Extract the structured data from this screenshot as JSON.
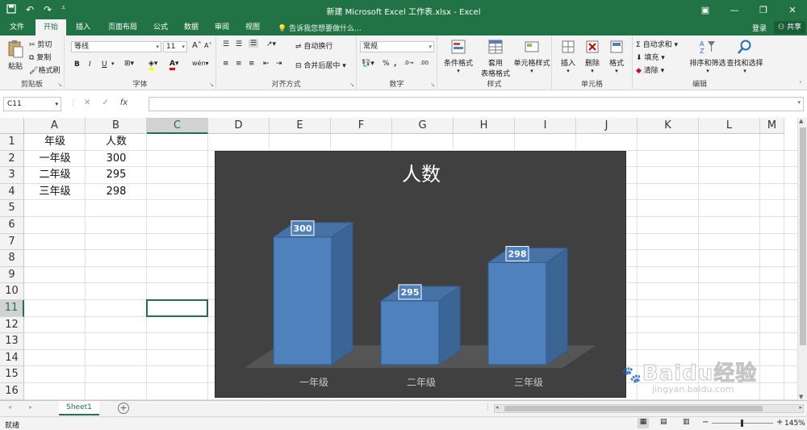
{
  "window": {
    "title": "新建 Microsoft Excel 工作表.xlsx - Excel"
  },
  "ribbon_tabs": [
    "文件",
    "开始",
    "插入",
    "页面布局",
    "公式",
    "数据",
    "审阅",
    "视图"
  ],
  "active_tab": "开始",
  "tell_me": "告诉我您想要做什么...",
  "account": {
    "signin": "登录",
    "share": "共享"
  },
  "clipboard": {
    "paste": "粘贴",
    "cut": "剪切",
    "copy": "复制",
    "painter": "格式刷",
    "label": "剪贴板"
  },
  "font": {
    "name": "等线",
    "size": "11",
    "label": "字体",
    "bold": "B",
    "italic": "I",
    "underline": "U",
    "increase": "A",
    "decrease": "A",
    "phonetic": "wén"
  },
  "alignment": {
    "wrap": "自动换行",
    "merge": "合并后居中",
    "label": "对齐方式"
  },
  "number": {
    "format": "常规",
    "percent": "%",
    "comma": ",",
    "label": "数字"
  },
  "styles": {
    "conditional": "条件格式",
    "table_1": "套用",
    "table_2": "表格格式",
    "cell_styles": "单元格样式",
    "label": "样式"
  },
  "cells": {
    "insert": "插入",
    "delete": "删除",
    "format": "格式",
    "label": "单元格"
  },
  "editing": {
    "autosum": "自动求和",
    "fill": "填充",
    "clear": "清除",
    "sort": "排序和筛选",
    "find": "查找和选择",
    "label": "编辑"
  },
  "formula_bar": {
    "name_box": "C11",
    "fx": "fx",
    "content": ""
  },
  "columns": [
    "A",
    "B",
    "C",
    "D",
    "E",
    "F",
    "G",
    "H",
    "I",
    "J",
    "K",
    "L",
    "M"
  ],
  "selected_column": "C",
  "rows": [
    "1",
    "2",
    "3",
    "4",
    "5",
    "6",
    "7",
    "8",
    "9",
    "10",
    "11",
    "12",
    "13",
    "14",
    "15",
    "16"
  ],
  "selected_row": "11",
  "cells_data": [
    [
      "年级",
      "人数"
    ],
    [
      "一年级",
      "300"
    ],
    [
      "二年级",
      "295"
    ],
    [
      "三年级",
      "298"
    ]
  ],
  "chart_data": {
    "type": "bar",
    "title": "人数",
    "categories": [
      "一年级",
      "二年级",
      "三年级"
    ],
    "values": [
      300,
      295,
      298
    ],
    "ylim": [
      290,
      301
    ],
    "series_color": "#4f81bd",
    "background": "#404040",
    "grid": false,
    "data_labels": true
  },
  "sheet_tabs": [
    "Sheet1"
  ],
  "status": {
    "ready": "就绪",
    "zoom": "145%"
  },
  "watermark": {
    "text": "Baidu经验",
    "url": "jingyan.baidu.com"
  }
}
